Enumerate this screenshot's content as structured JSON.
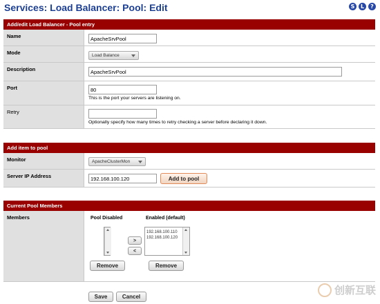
{
  "page": {
    "title": "Services: Load Balancer: Pool: Edit"
  },
  "colors": {
    "title": "#1c3f94",
    "section_header": "#990000",
    "label_bg": "#e0e0e0"
  },
  "top_icons": [
    {
      "name": "status-icon",
      "glyph": "S"
    },
    {
      "name": "log-icon",
      "glyph": "L"
    },
    {
      "name": "help-icon",
      "glyph": "?"
    }
  ],
  "pool_entry": {
    "header": "Add/edit Load Balancer - Pool entry",
    "name_label": "Name",
    "name_value": "ApacheSrvPool",
    "mode_label": "Mode",
    "mode_value": "Load Balance",
    "description_label": "Description",
    "description_value": "ApacheSrvPool",
    "port_label": "Port",
    "port_value": "80",
    "port_hint": "This is the port your servers are listening on.",
    "retry_label": "Retry",
    "retry_value": "",
    "retry_hint": "Optionally specify how many times to retry checking a server before declaring it down."
  },
  "add_item": {
    "header": "Add item to pool",
    "monitor_label": "Monitor",
    "monitor_value": "ApacheClusterMon",
    "server_ip_label": "Server IP Address",
    "server_ip_value": "192.168.100.120",
    "add_button": "Add to pool"
  },
  "members": {
    "header": "Current Pool Members",
    "label": "Members",
    "disabled_heading": "Pool Disabled",
    "enabled_heading": "Enabled (default)",
    "disabled_items": [],
    "enabled_items": [
      "192.168.100.110",
      "192.168.100.120"
    ],
    "move_right": ">",
    "move_left": "<",
    "remove_disabled": "Remove",
    "remove_enabled": "Remove"
  },
  "footer": {
    "save": "Save",
    "cancel": "Cancel"
  },
  "watermark": {
    "text": "创新互联"
  }
}
